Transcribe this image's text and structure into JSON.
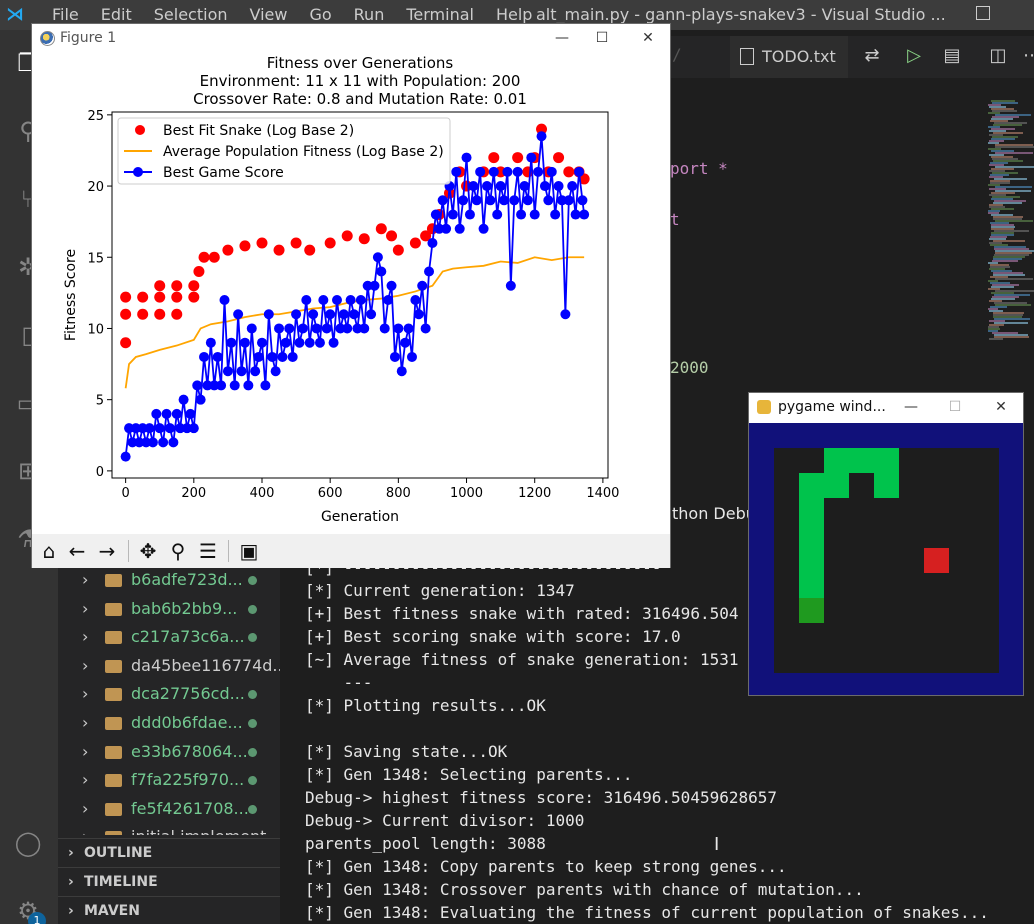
{
  "vscode": {
    "menu": [
      "File",
      "Edit",
      "Selection",
      "View",
      "Go",
      "Run",
      "Terminal",
      "Help"
    ],
    "window_title": "alt_main.py - gann-plays-snakev3 - Visual Studio ...",
    "tab": "TODO.txt",
    "code_fragments": {
      "import": "port *",
      "t_char": "t",
      "num": "2000",
      "slash": "/"
    },
    "panel_tab": "thon Debu",
    "sidebar_items": [
      {
        "name": "b6adfe723d...",
        "color": "green"
      },
      {
        "name": "bab6b2bb9...",
        "color": "green"
      },
      {
        "name": "c217a73c6a...",
        "color": "green"
      },
      {
        "name": "da45bee116774d...",
        "color": "white"
      },
      {
        "name": "dca27756cd...",
        "color": "green"
      },
      {
        "name": "ddd0b6fdae...",
        "color": "green"
      },
      {
        "name": "e33b678064...",
        "color": "green"
      },
      {
        "name": "f7fa225f970...",
        "color": "green"
      },
      {
        "name": "fe5f4261708...",
        "color": "green"
      },
      {
        "name": "initial implement",
        "color": "white"
      }
    ],
    "sections": [
      "OUTLINE",
      "TIMELINE",
      "MAVEN"
    ],
    "badge": "1"
  },
  "terminal_lines": [
    "[*] ---------------------------------",
    "[*] Current generation: 1347",
    "[+] Best fitness snake with rated: 316496.504",
    "[+] Best scoring snake with score: 17.0",
    "[~] Average fitness of snake generation: 1531",
    "    ---",
    "[*] Plotting results...OK",
    "",
    "[*] Saving state...OK",
    "[*] Gen 1348: Selecting parents...",
    "Debug-> highest fitness score: 316496.50459628657",
    "Debug-> Current divisor: 1000",
    "parents_pool length: 3088",
    "[*] Gen 1348: Copy parents to keep strong genes...",
    "[*] Gen 1348: Crossover parents with chance of mutation...",
    "[*] Gen 1348: Evaluating the fitness of current population of snakes..."
  ],
  "figure": {
    "window_title": "Figure 1",
    "toolbar_icons": [
      "home-icon",
      "back-arrow-icon",
      "forward-arrow-icon",
      "pan-icon",
      "zoom-icon",
      "configure-subplots-icon",
      "save-icon"
    ]
  },
  "pygame": {
    "window_title": "pygame wind...",
    "colors": {
      "border": "#11117a",
      "field": "#1d1d1d",
      "snake": "#00c34c",
      "head": "#1f9a1f",
      "food": "#d62020"
    },
    "grid_size": 9,
    "snake_body": [
      [
        2,
        0
      ],
      [
        3,
        0
      ],
      [
        4,
        0
      ],
      [
        1,
        1
      ],
      [
        2,
        1
      ],
      [
        4,
        1
      ],
      [
        1,
        2
      ],
      [
        1,
        3
      ],
      [
        1,
        4
      ],
      [
        1,
        5
      ]
    ],
    "snake_head": [
      1,
      6
    ],
    "food": [
      6,
      4
    ]
  },
  "chart_data": {
    "type": "line",
    "title": "Fitness over Generations\nEnvironment: 11 x 11 with Population: 200\nCrossover Rate: 0.8 and Mutation Rate: 0.01",
    "xlabel": "Generation",
    "ylabel": "Fitness Score",
    "xlim": [
      -40,
      1415
    ],
    "ylim": [
      -0.5,
      25.2
    ],
    "xticks": [
      0,
      200,
      400,
      600,
      800,
      1000,
      1200,
      1400
    ],
    "yticks": [
      0,
      5,
      10,
      15,
      20,
      25
    ],
    "legend_position": "upper-left",
    "series": [
      {
        "name": "Best Fit Snake (Log Base 2)",
        "marker": "o",
        "color": "#ff0000",
        "points": [
          [
            0,
            9
          ],
          [
            0,
            11
          ],
          [
            0,
            12.2
          ],
          [
            50,
            11
          ],
          [
            50,
            12.2
          ],
          [
            100,
            11
          ],
          [
            100,
            12.2
          ],
          [
            100,
            13
          ],
          [
            150,
            11
          ],
          [
            150,
            12.2
          ],
          [
            150,
            13
          ],
          [
            200,
            12.2
          ],
          [
            200,
            13
          ],
          [
            215,
            14
          ],
          [
            230,
            15
          ],
          [
            260,
            15
          ],
          [
            300,
            15.5
          ],
          [
            350,
            15.8
          ],
          [
            400,
            16
          ],
          [
            450,
            15.5
          ],
          [
            500,
            16
          ],
          [
            540,
            15.5
          ],
          [
            600,
            16
          ],
          [
            650,
            16.5
          ],
          [
            700,
            16.3
          ],
          [
            750,
            17
          ],
          [
            780,
            16.5
          ],
          [
            800,
            15.5
          ],
          [
            850,
            16
          ],
          [
            880,
            16.5
          ],
          [
            900,
            17
          ],
          [
            920,
            18
          ],
          [
            950,
            19.5
          ],
          [
            980,
            21
          ],
          [
            1000,
            20
          ],
          [
            1050,
            21
          ],
          [
            1080,
            22
          ],
          [
            1100,
            21
          ],
          [
            1150,
            22
          ],
          [
            1180,
            21
          ],
          [
            1200,
            22
          ],
          [
            1220,
            24
          ],
          [
            1240,
            21
          ],
          [
            1270,
            22
          ],
          [
            1300,
            21
          ],
          [
            1330,
            21
          ],
          [
            1345,
            20.5
          ]
        ]
      },
      {
        "name": "Average Population Fitness (Log Base 2)",
        "color": "#ffa500",
        "points": [
          [
            0,
            5.8
          ],
          [
            10,
            7.5
          ],
          [
            30,
            8
          ],
          [
            60,
            8.2
          ],
          [
            100,
            8.5
          ],
          [
            150,
            8.8
          ],
          [
            200,
            9.2
          ],
          [
            220,
            10
          ],
          [
            250,
            10.3
          ],
          [
            300,
            10.5
          ],
          [
            350,
            10.8
          ],
          [
            400,
            11
          ],
          [
            450,
            11
          ],
          [
            500,
            11.2
          ],
          [
            550,
            11.4
          ],
          [
            600,
            11.5
          ],
          [
            650,
            11.8
          ],
          [
            700,
            12
          ],
          [
            750,
            12.1
          ],
          [
            800,
            12.3
          ],
          [
            850,
            12.6
          ],
          [
            900,
            13
          ],
          [
            930,
            14
          ],
          [
            960,
            14.2
          ],
          [
            1000,
            14.3
          ],
          [
            1050,
            14.4
          ],
          [
            1100,
            14.7
          ],
          [
            1150,
            14.6
          ],
          [
            1200,
            15
          ],
          [
            1250,
            14.8
          ],
          [
            1300,
            15
          ],
          [
            1345,
            15
          ]
        ]
      },
      {
        "name": "Best Game Score",
        "marker": "o",
        "color": "#0000ff",
        "points": [
          [
            0,
            1
          ],
          [
            10,
            3
          ],
          [
            20,
            2
          ],
          [
            30,
            3
          ],
          [
            40,
            2
          ],
          [
            50,
            3
          ],
          [
            60,
            2
          ],
          [
            70,
            3
          ],
          [
            80,
            2
          ],
          [
            90,
            4
          ],
          [
            100,
            3
          ],
          [
            110,
            2
          ],
          [
            120,
            4
          ],
          [
            130,
            3
          ],
          [
            140,
            2
          ],
          [
            150,
            4
          ],
          [
            160,
            3
          ],
          [
            170,
            5
          ],
          [
            180,
            3
          ],
          [
            190,
            4
          ],
          [
            200,
            3
          ],
          [
            210,
            6
          ],
          [
            220,
            5
          ],
          [
            230,
            8
          ],
          [
            240,
            6
          ],
          [
            250,
            9
          ],
          [
            260,
            6
          ],
          [
            270,
            8
          ],
          [
            280,
            6
          ],
          [
            290,
            12
          ],
          [
            300,
            7
          ],
          [
            310,
            9
          ],
          [
            320,
            6
          ],
          [
            330,
            11
          ],
          [
            340,
            7
          ],
          [
            350,
            9
          ],
          [
            360,
            6
          ],
          [
            370,
            10
          ],
          [
            380,
            7
          ],
          [
            390,
            8
          ],
          [
            400,
            9
          ],
          [
            410,
            6
          ],
          [
            420,
            11
          ],
          [
            430,
            8
          ],
          [
            440,
            7
          ],
          [
            450,
            10
          ],
          [
            460,
            8
          ],
          [
            470,
            9
          ],
          [
            480,
            10
          ],
          [
            490,
            8
          ],
          [
            500,
            11
          ],
          [
            510,
            9
          ],
          [
            520,
            10
          ],
          [
            530,
            12
          ],
          [
            540,
            9
          ],
          [
            550,
            11
          ],
          [
            560,
            10
          ],
          [
            570,
            9
          ],
          [
            580,
            12
          ],
          [
            590,
            10
          ],
          [
            600,
            11
          ],
          [
            610,
            9
          ],
          [
            620,
            12
          ],
          [
            630,
            10
          ],
          [
            640,
            11
          ],
          [
            650,
            10
          ],
          [
            660,
            12
          ],
          [
            670,
            11
          ],
          [
            680,
            10
          ],
          [
            690,
            12
          ],
          [
            700,
            10
          ],
          [
            710,
            13
          ],
          [
            720,
            11
          ],
          [
            730,
            13
          ],
          [
            740,
            15
          ],
          [
            750,
            14
          ],
          [
            760,
            10
          ],
          [
            770,
            12
          ],
          [
            780,
            13
          ],
          [
            790,
            8
          ],
          [
            800,
            10
          ],
          [
            810,
            7
          ],
          [
            820,
            9
          ],
          [
            830,
            10
          ],
          [
            840,
            8
          ],
          [
            850,
            12
          ],
          [
            860,
            11
          ],
          [
            870,
            13
          ],
          [
            880,
            10
          ],
          [
            890,
            14
          ],
          [
            900,
            16
          ],
          [
            910,
            18
          ],
          [
            920,
            17
          ],
          [
            930,
            19
          ],
          [
            940,
            17
          ],
          [
            950,
            20
          ],
          [
            960,
            18
          ],
          [
            970,
            21
          ],
          [
            980,
            17
          ],
          [
            990,
            19
          ],
          [
            1000,
            22
          ],
          [
            1010,
            18
          ],
          [
            1020,
            20
          ],
          [
            1030,
            19
          ],
          [
            1040,
            21
          ],
          [
            1050,
            17
          ],
          [
            1060,
            20
          ],
          [
            1070,
            19
          ],
          [
            1080,
            21
          ],
          [
            1090,
            18
          ],
          [
            1100,
            20
          ],
          [
            1110,
            19
          ],
          [
            1120,
            21
          ],
          [
            1130,
            13
          ],
          [
            1140,
            19
          ],
          [
            1150,
            21
          ],
          [
            1160,
            18
          ],
          [
            1170,
            20
          ],
          [
            1180,
            19
          ],
          [
            1190,
            22
          ],
          [
            1200,
            18
          ],
          [
            1210,
            21
          ],
          [
            1220,
            23.5
          ],
          [
            1230,
            20
          ],
          [
            1240,
            19
          ],
          [
            1250,
            21
          ],
          [
            1260,
            18
          ],
          [
            1270,
            20
          ],
          [
            1280,
            19
          ],
          [
            1290,
            11
          ],
          [
            1300,
            19
          ],
          [
            1310,
            20
          ],
          [
            1320,
            18
          ],
          [
            1330,
            21
          ],
          [
            1340,
            19
          ],
          [
            1345,
            18
          ]
        ]
      }
    ]
  }
}
